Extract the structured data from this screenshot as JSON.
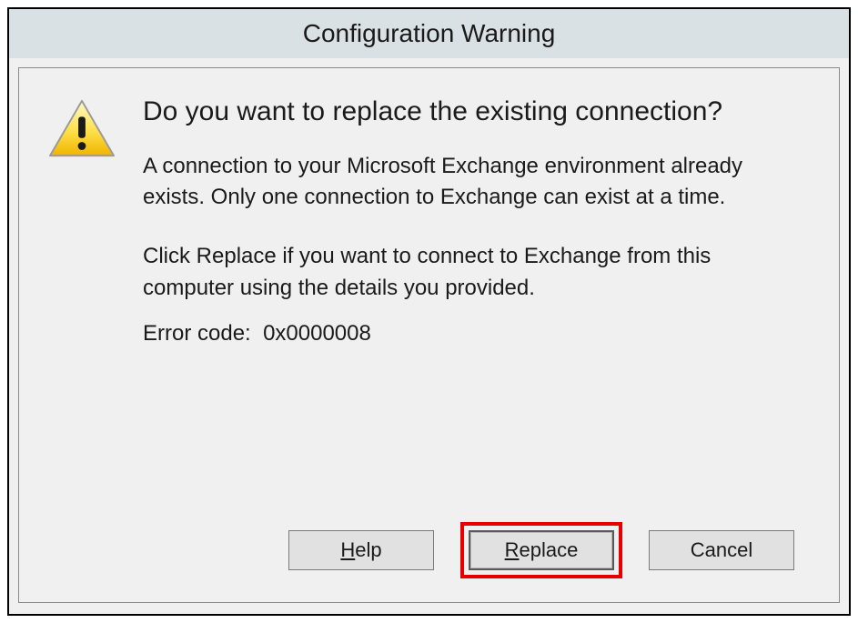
{
  "dialog": {
    "title": "Configuration Warning",
    "heading": "Do you want to replace the existing connection?",
    "paragraph1": "A connection to your Microsoft Exchange environment already exists. Only one connection to Exchange can exist at a time.",
    "paragraph2": "Click Replace if you want to connect to Exchange from this computer using the details you provided.",
    "error_label": "Error code:",
    "error_code": "0x0000008",
    "buttons": {
      "help": {
        "accel": "H",
        "rest": "elp",
        "highlighted": false
      },
      "replace": {
        "accel": "R",
        "rest": "eplace",
        "highlighted": true
      },
      "cancel": {
        "full": "Cancel",
        "highlighted": false
      }
    }
  }
}
